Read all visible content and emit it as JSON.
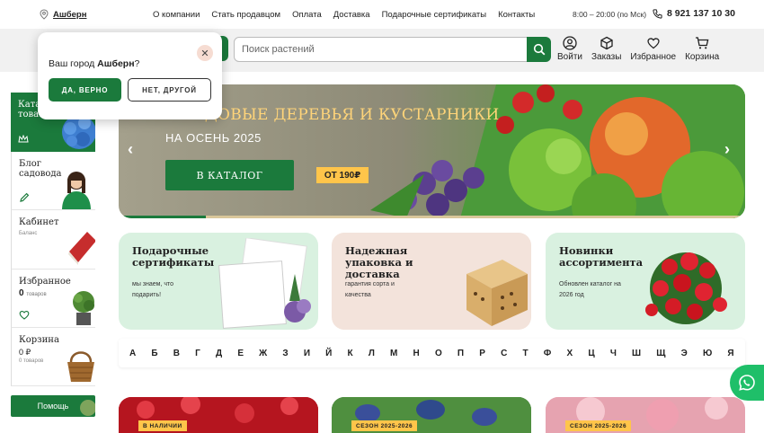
{
  "topbar": {
    "city": "Ашберн",
    "nav": [
      "О компании",
      "Стать продавцом",
      "Оплата",
      "Доставка",
      "Подарочные сертификаты",
      "Контакты"
    ],
    "hours": "8:00 – 20:00 (по Мск)",
    "phone": "8 921 137 10 30"
  },
  "header": {
    "search_placeholder": "Поиск растений",
    "icons": [
      {
        "label": "Войти",
        "icon": "user-icon"
      },
      {
        "label": "Заказы",
        "icon": "box-icon"
      },
      {
        "label": "Избранное",
        "icon": "heart-icon"
      },
      {
        "label": "Корзина",
        "icon": "cart-icon"
      }
    ]
  },
  "city_popup": {
    "question_prefix": "Ваш город",
    "city": "Ашберн",
    "question_suffix": "?",
    "yes": "ДА, ВЕРНО",
    "no": "НЕТ, ДРУГОЙ"
  },
  "sidebar": {
    "catalog_label": "Ката… това…",
    "blog": "Блог садовода",
    "cabinet": "Кабинет",
    "cabinet_sub": "Баланс",
    "favorites": "Избранное",
    "favorites_count": "0",
    "favorites_unit": "товаров",
    "cart": "Корзина",
    "cart_sum": "0 ₽",
    "cart_unit": "0 товаров",
    "help": "Помощь"
  },
  "banner": {
    "title": "ПЛОДОВЫЕ ДЕРЕВЬЯ И КУСТАРНИКИ",
    "subtitle": "НА ОСЕНЬ 2025",
    "button": "В КАТАЛОГ",
    "price": "ОТ 190₽"
  },
  "promos": [
    {
      "title": "Подарочные сертификаты",
      "text": "мы знаем, что подарить!",
      "bg": "#d9f1e0"
    },
    {
      "title": "Надежная упаковка и доставка",
      "text": "гарантия сорта и качества",
      "bg": "#f3e3db"
    },
    {
      "title": "Новинки ассортимента",
      "text": "Обновлен каталог на 2026 год",
      "bg": "#d9f1e0"
    }
  ],
  "alphabet": [
    "А",
    "Б",
    "В",
    "Г",
    "Д",
    "Е",
    "Ж",
    "З",
    "И",
    "Й",
    "К",
    "Л",
    "М",
    "Н",
    "О",
    "П",
    "Р",
    "С",
    "Т",
    "Ф",
    "Х",
    "Ц",
    "Ч",
    "Ш",
    "Щ",
    "Э",
    "Ю",
    "Я"
  ],
  "bottom_cards": [
    {
      "tag": "В НАЛИЧИИ"
    },
    {
      "tag": "СЕЗОН 2025-2026"
    },
    {
      "tag": "СЕЗОН 2025-2026"
    }
  ],
  "colors": {
    "brand_green": "#1b7a3c",
    "accent_yellow": "#ffc54a",
    "whatsapp": "#1fbf69"
  }
}
